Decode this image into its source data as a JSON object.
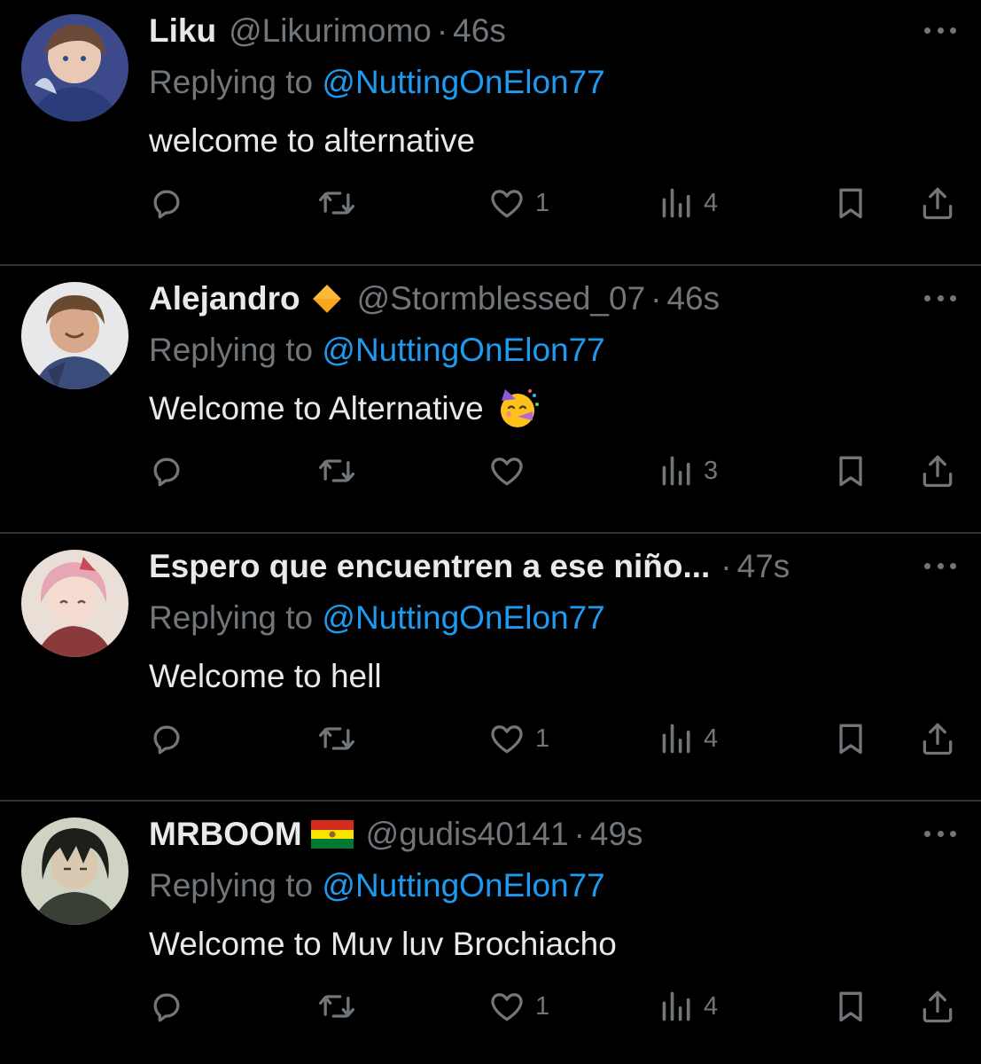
{
  "replies": [
    {
      "name": "Liku",
      "badge": "",
      "handle": "@Likurimomo",
      "separator": "·",
      "time": "46s",
      "replying_label": "Replying to",
      "replying_to": "@NuttingOnElon77",
      "text": "welcome to alternative",
      "emoji": "",
      "likes": "1",
      "views": "4",
      "avatar": {
        "bg": "#3c4a8c",
        "hair": "#6b4a3a",
        "skin": "#e9c9b4",
        "accent": "#2a3d7a"
      }
    },
    {
      "name": "Alejandro",
      "badge": "orange-diamond",
      "handle": "@Stormblessed_07",
      "separator": "·",
      "time": "46s",
      "replying_label": "Replying to",
      "replying_to": "@NuttingOnElon77",
      "text": "Welcome to Alternative",
      "emoji": "partying-face",
      "likes": "",
      "views": "3",
      "avatar": {
        "bg": "#e8e8ea",
        "hair": "#6a4a2e",
        "skin": "#d7a98a",
        "accent": "#3a4d7a"
      }
    },
    {
      "name": "Espero que encuentren a ese niño...",
      "badge": "",
      "handle": "",
      "separator": "·",
      "time": "47s",
      "replying_label": "Replying to",
      "replying_to": "@NuttingOnElon77",
      "text": "Welcome to hell",
      "emoji": "",
      "likes": "1",
      "views": "4",
      "avatar": {
        "bg": "#eadfd6",
        "hair": "#e7a6b4",
        "skin": "#f4ddd0",
        "accent": "#8a3a3a"
      }
    },
    {
      "name": "MRBOOM",
      "badge": "flag-bolivia",
      "handle": "@gudis40141",
      "separator": "·",
      "time": "49s",
      "replying_label": "Replying to",
      "replying_to": "@NuttingOnElon77",
      "text": "Welcome to Muv luv Brochiacho",
      "emoji": "",
      "likes": "1",
      "views": "4",
      "avatar": {
        "bg": "#cfd3c4",
        "hair": "#1d1f1a",
        "skin": "#d8c9b0",
        "accent": "#3a3f35"
      }
    }
  ],
  "icons": {
    "reply": "speech-bubble-icon",
    "retweet": "retweet-icon",
    "like": "heart-icon",
    "views": "bar-chart-icon",
    "bookmark": "bookmark-icon",
    "share": "share-icon",
    "more": "more-horizontal-icon"
  },
  "colors": {
    "background": "#000000",
    "text": "#e7e9ea",
    "muted": "#71767b",
    "accent": "#1d9bf0",
    "divider": "#2f3336"
  }
}
